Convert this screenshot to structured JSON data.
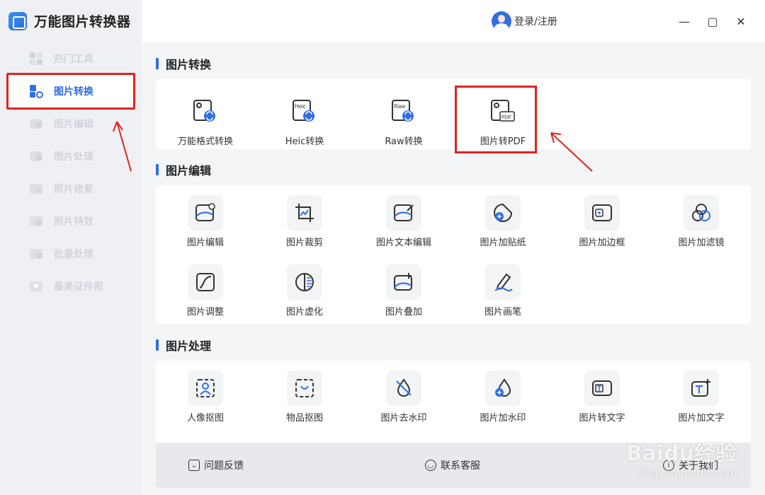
{
  "app": {
    "title": "万能图片转换器"
  },
  "header": {
    "login_label": "登录/注册"
  },
  "window_controls": {
    "minimize": "—",
    "maximize": "▢",
    "close": "✕"
  },
  "sidebar": {
    "items": [
      {
        "label": "热门工具",
        "icon": "grid-icon",
        "active": false
      },
      {
        "label": "图片转换",
        "icon": "convert-icon",
        "active": true
      },
      {
        "label": "图片编辑",
        "icon": "image-edit-icon",
        "active": false
      },
      {
        "label": "图片处理",
        "icon": "image-process-icon",
        "active": false
      },
      {
        "label": "照片修复",
        "icon": "photo-repair-icon",
        "active": false
      },
      {
        "label": "照片特效",
        "icon": "photo-effect-icon",
        "active": false
      },
      {
        "label": "批量处理",
        "icon": "batch-icon",
        "active": false
      },
      {
        "label": "最美证件照",
        "icon": "id-photo-icon",
        "active": false
      }
    ]
  },
  "sections": {
    "convert": {
      "title": "图片转换",
      "tools": [
        {
          "label": "万能格式转换",
          "icon": "format-convert-icon"
        },
        {
          "label": "Heic转换",
          "icon": "heic-icon"
        },
        {
          "label": "Raw转换",
          "icon": "raw-icon"
        },
        {
          "label": "图片转PDF",
          "icon": "image-to-pdf-icon"
        }
      ]
    },
    "edit": {
      "title": "图片编辑",
      "tools": [
        {
          "label": "图片编辑",
          "icon": "image-settings-icon"
        },
        {
          "label": "图片裁剪",
          "icon": "crop-icon"
        },
        {
          "label": "图片文本编辑",
          "icon": "image-text-edit-icon"
        },
        {
          "label": "图片加贴纸",
          "icon": "sticker-icon"
        },
        {
          "label": "图片加边框",
          "icon": "frame-icon"
        },
        {
          "label": "图片加滤镜",
          "icon": "filter-icon"
        },
        {
          "label": "图片调整",
          "icon": "curve-icon"
        },
        {
          "label": "图片虚化",
          "icon": "blur-icon"
        },
        {
          "label": "图片叠加",
          "icon": "overlay-icon"
        },
        {
          "label": "图片画笔",
          "icon": "pen-icon"
        }
      ]
    },
    "process": {
      "title": "图片处理",
      "tools": [
        {
          "label": "人像抠图",
          "icon": "portrait-cutout-icon"
        },
        {
          "label": "物品抠图",
          "icon": "object-cutout-icon"
        },
        {
          "label": "图片去水印",
          "icon": "remove-watermark-icon"
        },
        {
          "label": "图片加水印",
          "icon": "add-watermark-icon"
        },
        {
          "label": "图片转文字",
          "icon": "image-to-text-icon"
        },
        {
          "label": "图片加文字",
          "icon": "add-text-icon"
        }
      ]
    }
  },
  "footer": {
    "feedback": "问题反馈",
    "contact": "联系客服",
    "about": "关于我们"
  },
  "watermark": {
    "text": "Baidu经验",
    "sub": "jingyan.baidu.com"
  },
  "colors": {
    "accent": "#2f6ee6",
    "highlight_red": "#e0231c",
    "sidebar_bg": "#eef0f4"
  }
}
